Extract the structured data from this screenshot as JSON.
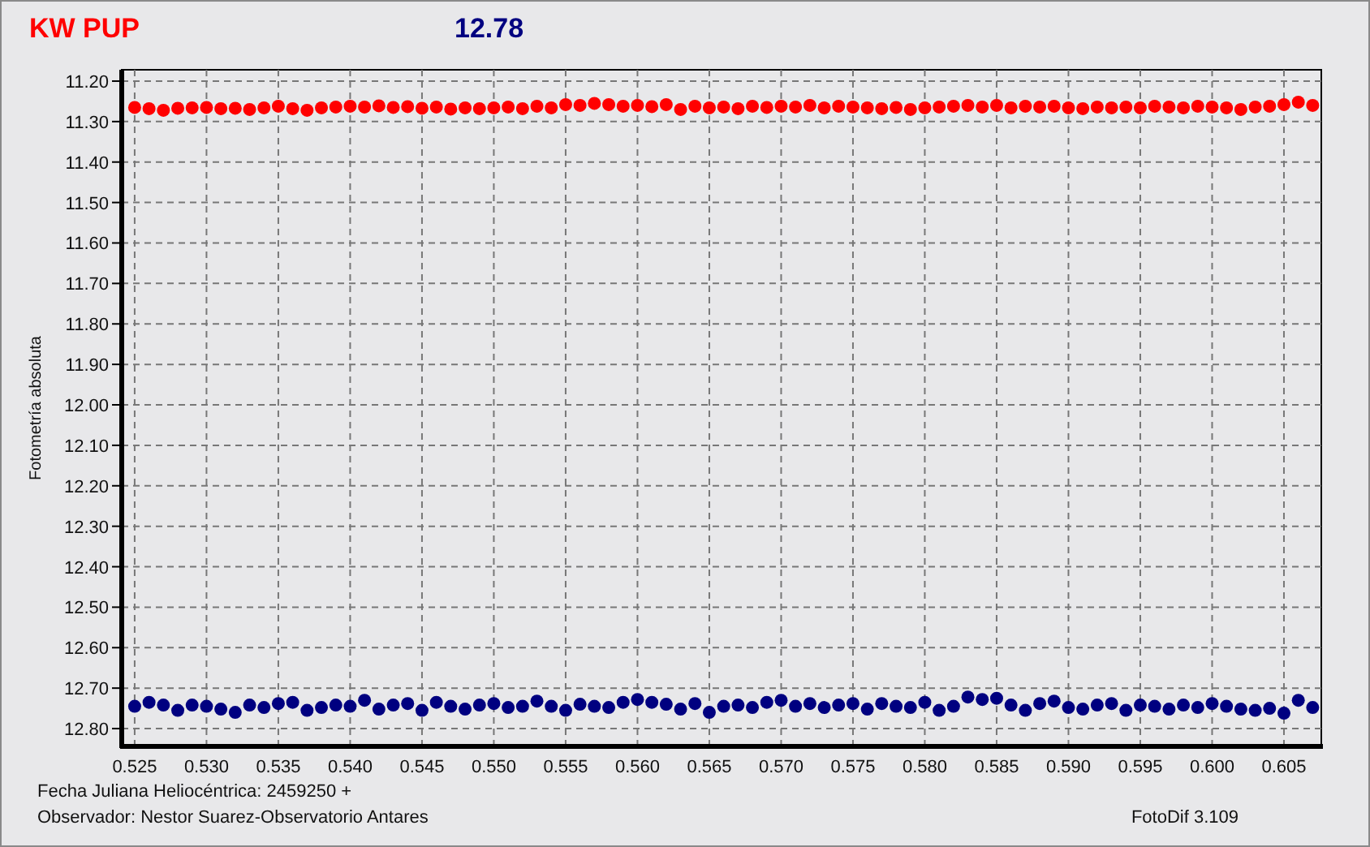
{
  "header": {
    "title": "KW PUP",
    "value": "12.78"
  },
  "chart": {
    "chart_data": {
      "type": "scatter",
      "ylabel": "Fotometría absoluta",
      "x": [
        0.525,
        0.526,
        0.527,
        0.528,
        0.529,
        0.53,
        0.531,
        0.532,
        0.533,
        0.534,
        0.535,
        0.536,
        0.537,
        0.538,
        0.539,
        0.54,
        0.541,
        0.542,
        0.543,
        0.544,
        0.545,
        0.546,
        0.547,
        0.548,
        0.549,
        0.55,
        0.551,
        0.552,
        0.553,
        0.554,
        0.555,
        0.556,
        0.557,
        0.558,
        0.559,
        0.56,
        0.561,
        0.562,
        0.563,
        0.564,
        0.565,
        0.566,
        0.567,
        0.568,
        0.569,
        0.57,
        0.571,
        0.572,
        0.573,
        0.574,
        0.575,
        0.576,
        0.577,
        0.578,
        0.579,
        0.58,
        0.581,
        0.582,
        0.583,
        0.584,
        0.585,
        0.586,
        0.587,
        0.588,
        0.589,
        0.59,
        0.591,
        0.592,
        0.593,
        0.594,
        0.595,
        0.596,
        0.597,
        0.598,
        0.599,
        0.6,
        0.601,
        0.602,
        0.603,
        0.604,
        0.605,
        0.606,
        0.607
      ],
      "series": [
        {
          "color": "#ff0000",
          "values": [
            11.265,
            11.268,
            11.272,
            11.267,
            11.266,
            11.265,
            11.268,
            11.267,
            11.27,
            11.266,
            11.262,
            11.268,
            11.272,
            11.266,
            11.264,
            11.262,
            11.264,
            11.261,
            11.265,
            11.263,
            11.267,
            11.264,
            11.269,
            11.266,
            11.268,
            11.266,
            11.264,
            11.268,
            11.262,
            11.266,
            11.258,
            11.26,
            11.255,
            11.258,
            11.262,
            11.26,
            11.263,
            11.258,
            11.27,
            11.262,
            11.266,
            11.264,
            11.268,
            11.262,
            11.265,
            11.262,
            11.264,
            11.26,
            11.266,
            11.262,
            11.264,
            11.266,
            11.268,
            11.265,
            11.27,
            11.266,
            11.264,
            11.262,
            11.26,
            11.264,
            11.26,
            11.266,
            11.262,
            11.264,
            11.262,
            11.266,
            11.268,
            11.264,
            11.266,
            11.264,
            11.266,
            11.262,
            11.264,
            11.266,
            11.262,
            11.264,
            11.266,
            11.27,
            11.264,
            11.262,
            11.258,
            11.252,
            11.26
          ]
        },
        {
          "color": "#000080",
          "values": [
            12.745,
            12.735,
            12.742,
            12.755,
            12.742,
            12.745,
            12.752,
            12.76,
            12.742,
            12.748,
            12.738,
            12.735,
            12.755,
            12.748,
            12.742,
            12.745,
            12.73,
            12.752,
            12.742,
            12.738,
            12.755,
            12.735,
            12.745,
            12.752,
            12.742,
            12.738,
            12.748,
            12.745,
            12.732,
            12.745,
            12.755,
            12.74,
            12.745,
            12.748,
            12.735,
            12.728,
            12.735,
            12.74,
            12.752,
            12.738,
            12.76,
            12.745,
            12.742,
            12.748,
            12.735,
            12.73,
            12.745,
            12.738,
            12.748,
            12.742,
            12.738,
            12.752,
            12.738,
            12.745,
            12.748,
            12.735,
            12.755,
            12.745,
            12.722,
            12.728,
            12.725,
            12.742,
            12.755,
            12.738,
            12.732,
            12.748,
            12.752,
            12.742,
            12.738,
            12.755,
            12.742,
            12.745,
            12.752,
            12.742,
            12.748,
            12.738,
            12.745,
            12.752,
            12.755,
            12.75,
            12.762,
            12.73,
            12.748
          ]
        }
      ],
      "grid": true,
      "xlim": [
        0.5241,
        0.6076
      ],
      "ylim": [
        12.844,
        11.172
      ],
      "xticks": [
        {
          "value": 0.525,
          "label": "0.525"
        },
        {
          "value": 0.53,
          "label": "0.530"
        },
        {
          "value": 0.535,
          "label": "0.535"
        },
        {
          "value": 0.54,
          "label": "0.540"
        },
        {
          "value": 0.545,
          "label": "0.545"
        },
        {
          "value": 0.55,
          "label": "0.550"
        },
        {
          "value": 0.555,
          "label": "0.555"
        },
        {
          "value": 0.56,
          "label": "0.560"
        },
        {
          "value": 0.565,
          "label": "0.565"
        },
        {
          "value": 0.57,
          "label": "0.570"
        },
        {
          "value": 0.575,
          "label": "0.575"
        },
        {
          "value": 0.58,
          "label": "0.580"
        },
        {
          "value": 0.585,
          "label": "0.585"
        },
        {
          "value": 0.59,
          "label": "0.590"
        },
        {
          "value": 0.595,
          "label": "0.595"
        },
        {
          "value": 0.6,
          "label": "0.600"
        },
        {
          "value": 0.605,
          "label": "0.605"
        }
      ],
      "yticks": [
        {
          "value": 11.2,
          "label": "11.20"
        },
        {
          "value": 11.3,
          "label": "11.30"
        },
        {
          "value": 11.4,
          "label": "11.40"
        },
        {
          "value": 11.5,
          "label": "11.50"
        },
        {
          "value": 11.6,
          "label": "11.60"
        },
        {
          "value": 11.7,
          "label": "11.70"
        },
        {
          "value": 11.8,
          "label": "11.80"
        },
        {
          "value": 11.9,
          "label": "11.90"
        },
        {
          "value": 12.0,
          "label": "12.00"
        },
        {
          "value": 12.1,
          "label": "12.10"
        },
        {
          "value": 12.2,
          "label": "12.20"
        },
        {
          "value": 12.3,
          "label": "12.30"
        },
        {
          "value": 12.4,
          "label": "12.40"
        },
        {
          "value": 12.5,
          "label": "12.50"
        },
        {
          "value": 12.6,
          "label": "12.60"
        },
        {
          "value": 12.7,
          "label": "12.70"
        },
        {
          "value": 12.8,
          "label": "12.80"
        }
      ]
    }
  },
  "footer": {
    "date_line": "Fecha Juliana Heliocéntrica: 2459250 +",
    "observer_line": "Observador: Nestor Suarez-Observatorio Antares",
    "version": "FotoDif 3.109"
  }
}
